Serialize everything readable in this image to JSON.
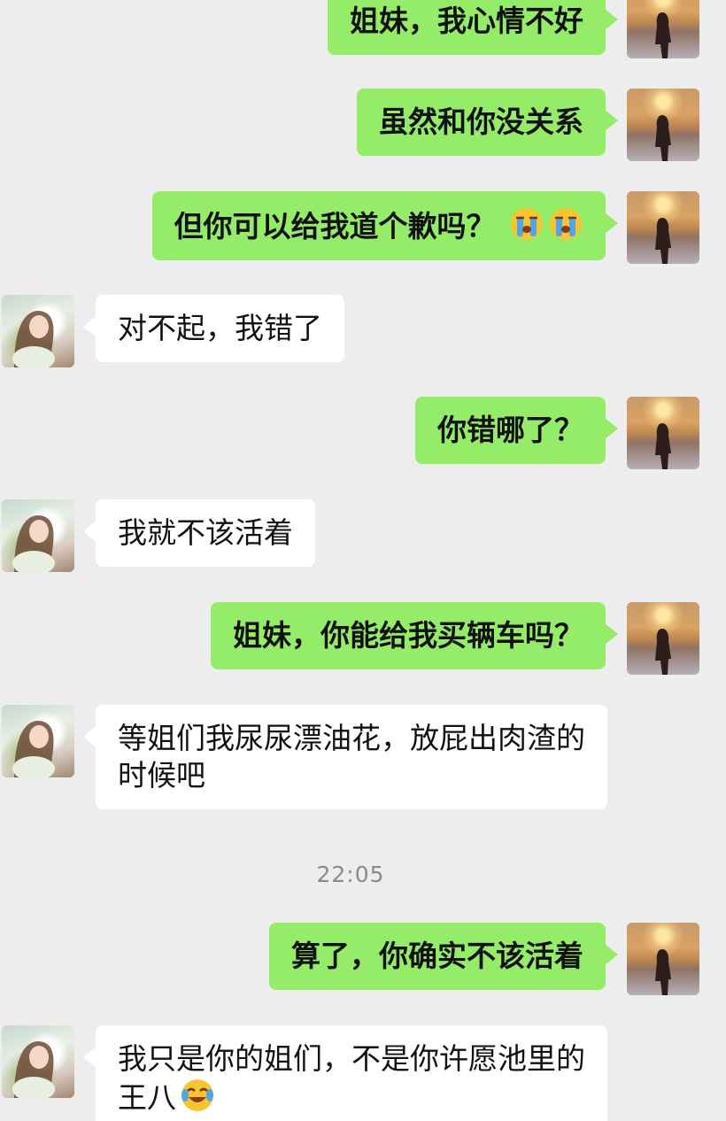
{
  "colors": {
    "background": "#ededed",
    "self_bubble": "#95ec69",
    "other_bubble": "#ffffff",
    "timestamp_text": "#8a8a8a"
  },
  "messages": [
    {
      "sender": "self",
      "text": "姐妹，我心情不好"
    },
    {
      "sender": "self",
      "text": "虽然和你没关系"
    },
    {
      "sender": "self",
      "text": "但你可以给我道个歉吗？",
      "emoji": [
        "crying-face-icon",
        "crying-face-icon"
      ]
    },
    {
      "sender": "other",
      "text": "对不起，我错了"
    },
    {
      "sender": "self",
      "text": "你错哪了？"
    },
    {
      "sender": "other",
      "text": "我就不该活着"
    },
    {
      "sender": "self",
      "text": "姐妹，你能给我买辆车吗？"
    },
    {
      "sender": "other",
      "text": "等姐们我尿尿漂油花，放屁出肉渣的时候吧"
    },
    {
      "sender": "self",
      "text": "算了，你确实不该活着"
    },
    {
      "sender": "other",
      "text": "我只是你的姐们，不是你许愿池里的王八",
      "emoji": [
        "laughing-crying-face-icon"
      ]
    }
  ],
  "timestamp": "22:05"
}
